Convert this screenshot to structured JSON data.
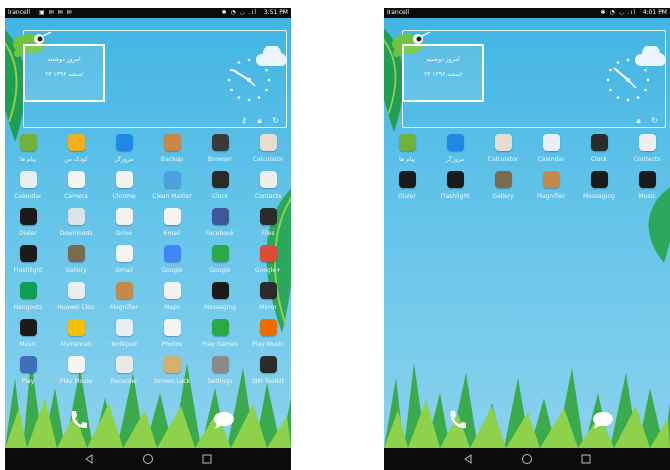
{
  "colors": {
    "sky": "#5ec0e8",
    "leaf_dark": "#1f9e54",
    "leaf_light": "#8ed14b",
    "statusbar": "#0b0b0b"
  },
  "left_phone": {
    "status": {
      "carrier": "Irancell",
      "notifications": "▣ ✉ ✉ ✉",
      "system_icons": "✱ ◔ ◡ .ıl",
      "clock": "3:51 PM"
    },
    "widget": {
      "day": "امروز دوشنبه",
      "date": "۲۳ اسفند ۱۳۹۶",
      "controls": [
        "key-icon",
        "lock-icon",
        "refresh-icon"
      ]
    },
    "apps": [
      {
        "label": "پیام ها",
        "icon": "messages-icon",
        "color": "#6fb13c"
      },
      {
        "label": "کودک من",
        "icon": "kids-icon",
        "color": "#f0b020"
      },
      {
        "label": "مرورگر",
        "icon": "browser-icon",
        "color": "#1e88e5"
      },
      {
        "label": "Backup",
        "icon": "backup-icon",
        "color": "#c9884a"
      },
      {
        "label": "Browser",
        "icon": "browser-icon",
        "color": "#3a3a3a"
      },
      {
        "label": "Calculator",
        "icon": "calculator-icon",
        "color": "#e6ddd2"
      },
      {
        "label": "Calendar",
        "icon": "calendar-icon",
        "color": "#e9eef2"
      },
      {
        "label": "Camera",
        "icon": "camera-icon",
        "color": "#f4f4f4"
      },
      {
        "label": "Chrome",
        "icon": "chrome-icon",
        "color": "#f2f2f2"
      },
      {
        "label": "Clean Master",
        "icon": "broom-icon",
        "color": "#4aa3df"
      },
      {
        "label": "Clock",
        "icon": "clock-icon",
        "color": "#2b2b2b"
      },
      {
        "label": "Contacts",
        "icon": "contacts-icon",
        "color": "#eeeeee"
      },
      {
        "label": "Dialer",
        "icon": "phone-icon",
        "color": "#1b1b1b"
      },
      {
        "label": "Downloads",
        "icon": "download-icon",
        "color": "#dde3e8"
      },
      {
        "label": "Drive",
        "icon": "drive-icon",
        "color": "#f2f2f2"
      },
      {
        "label": "Email",
        "icon": "email-icon",
        "color": "#f4f4f4"
      },
      {
        "label": "Facebook",
        "icon": "facebook-icon",
        "color": "#3b5998"
      },
      {
        "label": "Files",
        "icon": "files-icon",
        "color": "#2b2b2b"
      },
      {
        "label": "Flashlight",
        "icon": "flashlight-icon",
        "color": "#1b1b1b"
      },
      {
        "label": "Gallery",
        "icon": "gallery-icon",
        "color": "#7a6a50"
      },
      {
        "label": "Gmail",
        "icon": "gmail-icon",
        "color": "#f4f4f4"
      },
      {
        "label": "Google",
        "icon": "google-icon",
        "color": "#4285f4"
      },
      {
        "label": "Google",
        "icon": "google-plus-icon",
        "color": "#2aa84a"
      },
      {
        "label": "Google+",
        "icon": "google-plus-icon",
        "color": "#dd4b39"
      },
      {
        "label": "Hangouts",
        "icon": "hangouts-icon",
        "color": "#0f9d58"
      },
      {
        "label": "Huawei Clou",
        "icon": "cloud-icon",
        "color": "#e9eef2"
      },
      {
        "label": "Magnifier",
        "icon": "magnifier-icon",
        "color": "#c58a4a"
      },
      {
        "label": "Maps",
        "icon": "maps-icon",
        "color": "#f2f2f2"
      },
      {
        "label": "Messaging",
        "icon": "messaging-icon",
        "color": "#1b1b1b"
      },
      {
        "label": "Mirror",
        "icon": "mirror-icon",
        "color": "#2b2b2b"
      },
      {
        "label": "Music",
        "icon": "music-icon",
        "color": "#1b1b1b"
      },
      {
        "label": "Myirancell",
        "icon": "myirancell-icon",
        "color": "#f2c200"
      },
      {
        "label": "Notepad",
        "icon": "notepad-icon",
        "color": "#e9eef2"
      },
      {
        "label": "Photos",
        "icon": "photos-icon",
        "color": "#f4f4f4"
      },
      {
        "label": "Play Games",
        "icon": "gamepad-icon",
        "color": "#2aa84a"
      },
      {
        "label": "Play Music",
        "icon": "play-music-icon",
        "color": "#ef6c00"
      },
      {
        "label": "Play",
        "icon": "play-store-icon",
        "color": "#3f6fb6"
      },
      {
        "label": "Play Movie",
        "icon": "play-movies-icon",
        "color": "#f4f4f4"
      },
      {
        "label": "Recorder",
        "icon": "recorder-icon",
        "color": "#e9e9e9"
      },
      {
        "label": "Screen Lock",
        "icon": "screen-lock-icon",
        "color": "#d4b070"
      },
      {
        "label": "Settings",
        "icon": "settings-icon",
        "color": "#8a8a8a"
      },
      {
        "label": "SIM Toolkit",
        "icon": "sim-icon",
        "color": "#2b2b2b"
      }
    ],
    "dock": [
      "phone-icon",
      "chat-icon"
    ]
  },
  "right_phone": {
    "status": {
      "carrier": "Irancell",
      "notifications": "",
      "system_icons": "✱ ◔ ◡ .ıl",
      "clock": "4:01 PM"
    },
    "widget": {
      "day": "امروز دوشنبه",
      "date": "۲۳ اسفند ۱۳۹۶",
      "controls": [
        "lock-icon",
        "refresh-icon"
      ]
    },
    "apps": [
      {
        "label": "پیام ها",
        "icon": "messages-icon",
        "color": "#6fb13c"
      },
      {
        "label": "مرورگر",
        "icon": "browser-icon",
        "color": "#1e88e5"
      },
      {
        "label": "Calculator",
        "icon": "calculator-icon",
        "color": "#e6ddd2"
      },
      {
        "label": "Calendar",
        "icon": "calendar-icon",
        "color": "#e9eef2"
      },
      {
        "label": "Clock",
        "icon": "clock-icon",
        "color": "#2b2b2b"
      },
      {
        "label": "Contacts",
        "icon": "contacts-icon",
        "color": "#eeeeee"
      },
      {
        "label": "Dialer",
        "icon": "phone-icon",
        "color": "#1b1b1b"
      },
      {
        "label": "Flashlight",
        "icon": "flashlight-icon",
        "color": "#1b1b1b"
      },
      {
        "label": "Gallery",
        "icon": "gallery-icon",
        "color": "#7a6a50"
      },
      {
        "label": "Magnifier",
        "icon": "magnifier-icon",
        "color": "#c58a4a"
      },
      {
        "label": "Messaging",
        "icon": "messaging-icon",
        "color": "#1b1b1b"
      },
      {
        "label": "Music",
        "icon": "music-icon",
        "color": "#1b1b1b"
      }
    ],
    "dock": [
      "phone-icon",
      "chat-icon"
    ]
  },
  "navbar": [
    "back-icon",
    "home-icon",
    "recents-icon"
  ]
}
